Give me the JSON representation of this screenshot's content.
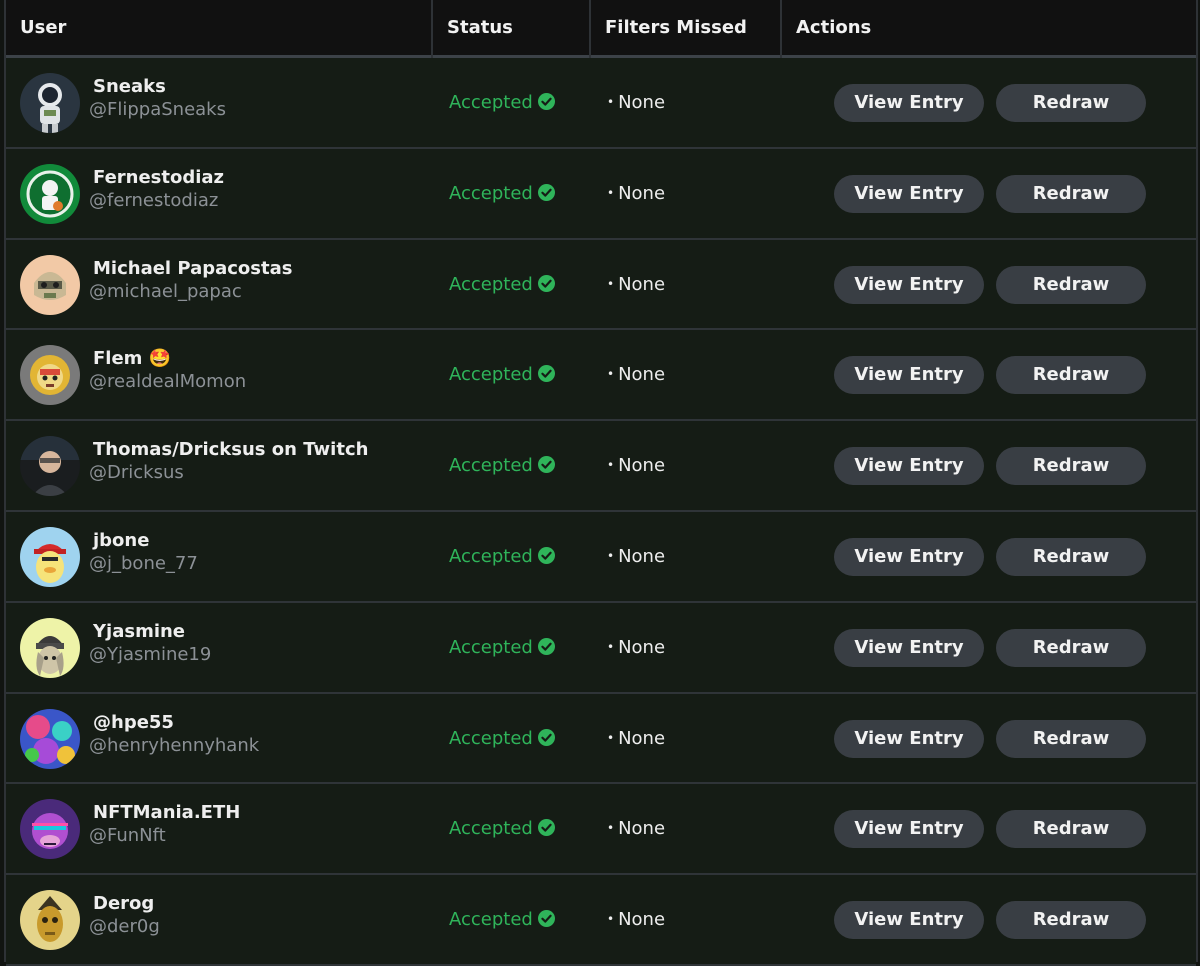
{
  "header": {
    "user": "User",
    "status": "Status",
    "filters_missed": "Filters Missed",
    "actions": "Actions"
  },
  "colors": {
    "accepted": "#2fb45a",
    "button_bg": "#393e44",
    "row_bg": "#151c15",
    "header_bg": "#111111"
  },
  "actions": {
    "view_entry": "View Entry",
    "redraw": "Redraw"
  },
  "rows": [
    {
      "name": "Sneaks",
      "handle": "@FlippaSneaks",
      "status": "Accepted",
      "filters": "None",
      "avatar": "astronaut-avatar"
    },
    {
      "name": "Fernestodiaz",
      "handle": "@fernestodiaz",
      "status": "Accepted",
      "filters": "None",
      "avatar": "green-logo-avatar"
    },
    {
      "name": "Michael Papacostas",
      "handle": "@michael_papac",
      "status": "Accepted",
      "filters": "None",
      "avatar": "helmet-avatar"
    },
    {
      "name": "Flem 🤩",
      "handle": "@realdealMomon",
      "status": "Accepted",
      "filters": "None",
      "avatar": "lion-avatar"
    },
    {
      "name": "Thomas/Dricksus on Twitch",
      "handle": "@Dricksus",
      "status": "Accepted",
      "filters": "None",
      "avatar": "photo-avatar"
    },
    {
      "name": "jbone",
      "handle": "@j_bone_77",
      "status": "Accepted",
      "filters": "None",
      "avatar": "duck-cap-avatar"
    },
    {
      "name": "Yjasmine",
      "handle": "@Yjasmine19",
      "status": "Accepted",
      "filters": "None",
      "avatar": "beanie-avatar"
    },
    {
      "name": "@hpe55",
      "handle": "@henryhennyhank",
      "status": "Accepted",
      "filters": "None",
      "avatar": "abstract-avatar"
    },
    {
      "name": "NFTMania.ETH",
      "handle": "@FunNft",
      "status": "Accepted",
      "filters": "None",
      "avatar": "ape-avatar"
    },
    {
      "name": "Derog",
      "handle": "@der0g",
      "status": "Accepted",
      "filters": "None",
      "avatar": "gold-mask-avatar"
    }
  ]
}
